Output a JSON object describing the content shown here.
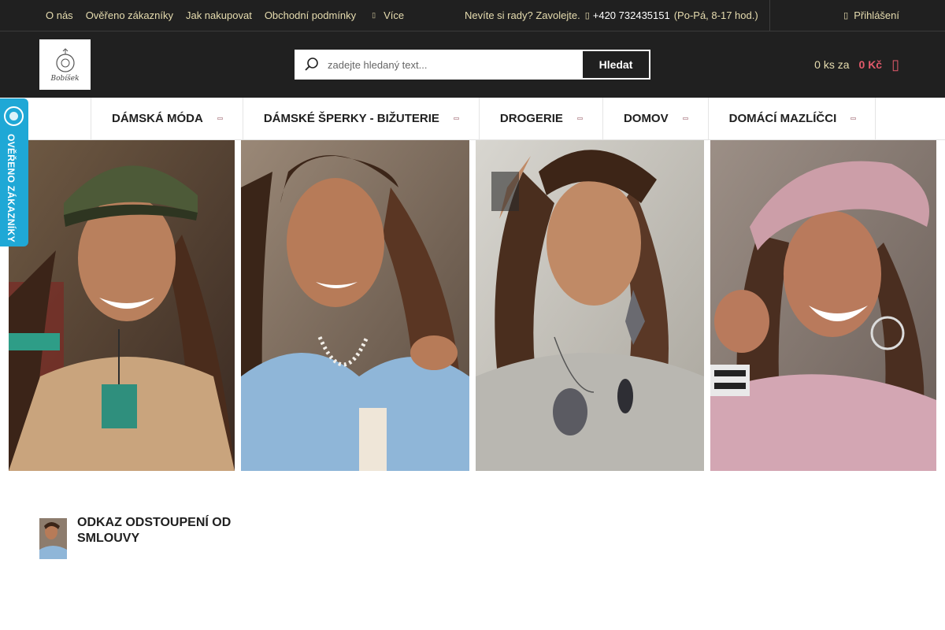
{
  "topbar": {
    "links": [
      "O nás",
      "Ověřeno zákazníky",
      "Jak nakupovat",
      "Obchodní podmínky"
    ],
    "more_label": "Více",
    "contact_text": "Nevíte si rady? Zavolejte.",
    "phone": "+420 732435151",
    "hours": "(Po-Pá, 8-17 hod.)",
    "login_label": "Přihlášení"
  },
  "header": {
    "logo_text": "Bobíšek",
    "search_placeholder": "zadejte hledaný text...",
    "search_button": "Hledat",
    "cart_qty": "0 ks za",
    "cart_price": "0 Kč"
  },
  "nav": {
    "items": [
      "DÁMSKÁ MÓDA",
      "DÁMSKÉ ŠPERKY - BIŽUTERIE",
      "DROGERIE",
      "DOMOV",
      "DOMÁCÍ MAZLÍČCI"
    ]
  },
  "badge": {
    "label": "OVĚŘENO ZÁKAZNÍKY"
  },
  "banners": [
    {
      "alt": "model-cap-beige-jacket"
    },
    {
      "alt": "model-blue-jacket-pearls"
    },
    {
      "alt": "model-grey-sweater-brooch"
    },
    {
      "alt": "model-pink-hat-sweater"
    }
  ],
  "article": {
    "title": "Odkaz odstoupení od smlouvy"
  },
  "colors": {
    "dark": "#202020",
    "gold": "#e6dcaf",
    "accent": "#e25a6b",
    "badge": "#1fa8d6"
  }
}
